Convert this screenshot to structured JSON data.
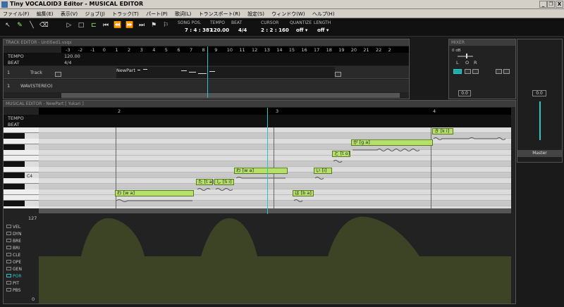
{
  "window": {
    "title": "Tiny VOCALOID3 Editor - MUSICAL EDITOR",
    "min": "_",
    "restore": "❐",
    "close": "X"
  },
  "menu": [
    {
      "label": "ファイル(F)"
    },
    {
      "label": "編集(E)"
    },
    {
      "label": "表示(V)"
    },
    {
      "label": "ジョブ(J)"
    },
    {
      "label": "トラック(T)"
    },
    {
      "label": "パート(P)"
    },
    {
      "label": "歌詞(L)"
    },
    {
      "label": "トランスポート(R)"
    },
    {
      "label": "設定(S)"
    },
    {
      "label": "ウィンドウ(W)"
    },
    {
      "label": "ヘルプ(H)"
    }
  ],
  "toolbar": {
    "song_pos_label": "SONG POS.",
    "song_pos": "7 : 4 : 387",
    "tempo_label": "TEMPO",
    "tempo": "120.00",
    "beat_label": "BEAT",
    "beat": "4/4",
    "cursor_label": "CURSOR",
    "cursor": "2 : 2 : 160",
    "quantize_label": "QUANTIZE",
    "quantize": "off ▾",
    "length_label": "LENGTH",
    "length": "off ▾"
  },
  "track_editor": {
    "title": "TRACK EDITOR - Untitled1.vsqx",
    "ruler": [
      "-3",
      "-2",
      "-1",
      "0",
      "1",
      "2",
      "3",
      "4",
      "5",
      "6",
      "7",
      "8",
      "9",
      "10",
      "11",
      "12",
      "13",
      "14",
      "15",
      "16",
      "17",
      "18",
      "19",
      "20",
      "21",
      "22",
      "2"
    ],
    "tempo_label": "TEMPO",
    "tempo_value": "120.00",
    "beat_label": "BEAT",
    "beat_value": "4/4",
    "tracks": [
      {
        "num": "1",
        "name": "Track",
        "part": "NewPart"
      },
      {
        "num": "1",
        "name": "WAV(STEREO)"
      }
    ]
  },
  "mixer": {
    "title": "MIXER",
    "pan": "0 dB",
    "l": "L",
    "o": "O",
    "r": "R",
    "gain": "0.0",
    "master_gain": "0.0",
    "master_label": "Master"
  },
  "musical_editor": {
    "title": "MUSICAL EDITOR - NewPart [ Yukari ]",
    "tempo_label": "TEMPO",
    "beat_label": "BEAT",
    "measures": [
      "2",
      "3",
      "4"
    ],
    "c4_label": "C4",
    "notes": [
      {
        "lyric": "わ [w a]"
      },
      {
        "lyric": "た [t a]"
      },
      {
        "lyric": "し [S i]"
      },
      {
        "lyric": "わ [w a]"
      },
      {
        "lyric": "い [i]"
      },
      {
        "lyric": "は [b a]"
      },
      {
        "lyric": "と [t o]"
      },
      {
        "lyric": "が [g a]"
      },
      {
        "lyric": "き [k i]"
      }
    ],
    "ctrl_max": "127",
    "ctrl_min": "0",
    "controls": [
      "VEL",
      "DYN",
      "BRE",
      "BRI",
      "CLE",
      "OPE",
      "GEN",
      "POR",
      "PIT",
      "PBS"
    ],
    "selected_control": "POR"
  },
  "colors": {
    "note": "#b5e06a",
    "playhead": "#2ec4c4",
    "ctrl_fill": "#3d4426"
  }
}
